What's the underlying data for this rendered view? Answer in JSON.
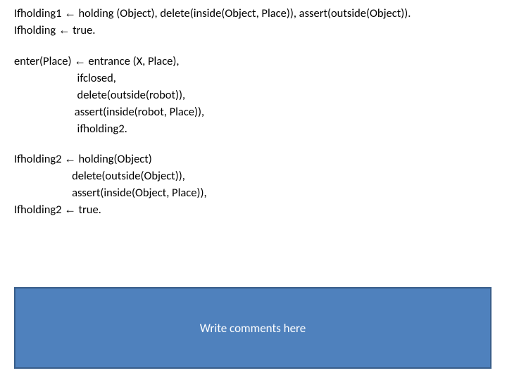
{
  "rules": {
    "ifholding1": {
      "head": "Ifholding1",
      "body": "holding (Object), delete(inside(Object, Place)), assert(outside(Object))."
    },
    "ifholding_true": {
      "head": "Ifholding",
      "body": "true."
    },
    "enter": {
      "head": "enter(Place)",
      "body_lines": [
        "entrance (X, Place),",
        "ifclosed,",
        "delete(outside(robot)),",
        "assert(inside(robot, Place)),",
        "ifholding2."
      ]
    },
    "ifholding2": {
      "head": "Ifholding2",
      "body_lines": [
        "holding(Object)",
        "delete(outside(Object)),",
        "assert(inside(Object, Place)),"
      ]
    },
    "ifholding2_true": {
      "head": "Ifholding2",
      "body": "true."
    }
  },
  "arrow": "←",
  "comment_box": {
    "text": "Write comments here",
    "bg_color": "#4f81bd",
    "border_color": "#385d8a"
  }
}
